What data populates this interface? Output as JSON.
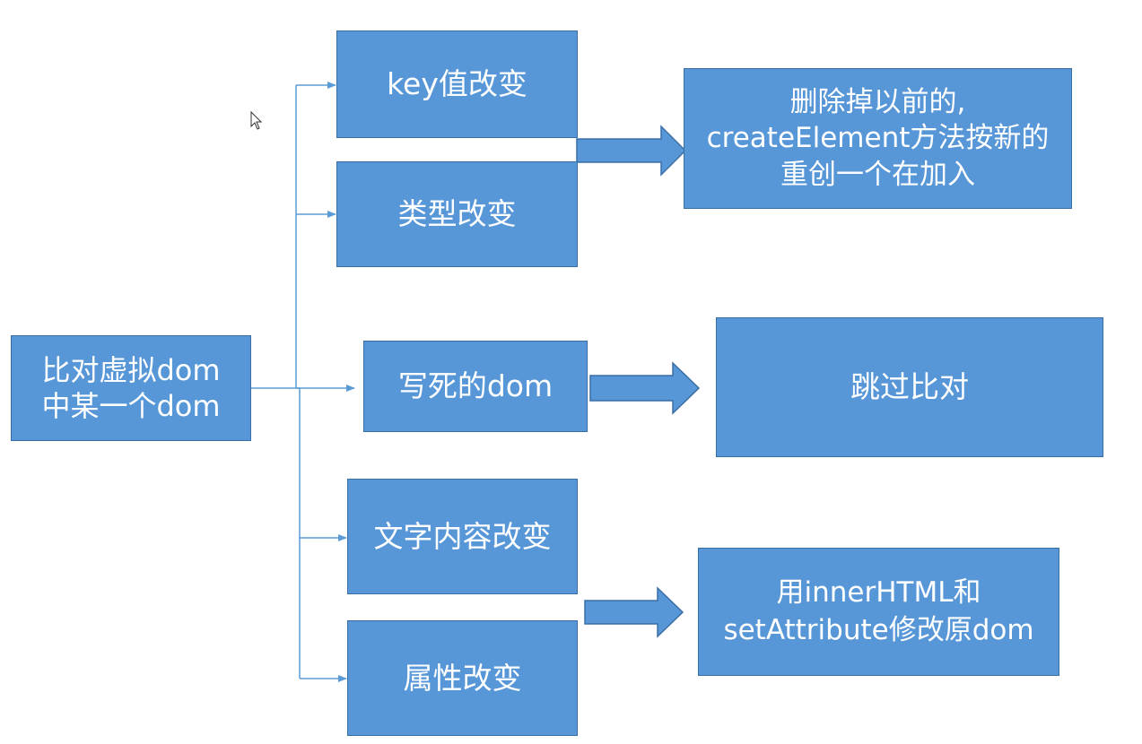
{
  "diagram": {
    "root": {
      "line1": "比对虚拟dom",
      "line2": "中某一个dom"
    },
    "branches": {
      "key_change": "key值改变",
      "type_change": "类型改变",
      "static_dom": "写死的dom",
      "text_change": "文字内容改变",
      "attr_change": "属性改变"
    },
    "results": {
      "recreate": {
        "line1": "删除掉以前的,",
        "line2": "createElement方法按新的",
        "line3": "重创一个在加入"
      },
      "skip": "跳过比对",
      "modify": {
        "line1": "用innerHTML和",
        "line2": "setAttribute修改原dom"
      }
    },
    "colors": {
      "box_fill": "#5797d8",
      "box_border": "#3a6fa5",
      "connector": "#5b9bd5",
      "text": "#ffffff"
    }
  }
}
